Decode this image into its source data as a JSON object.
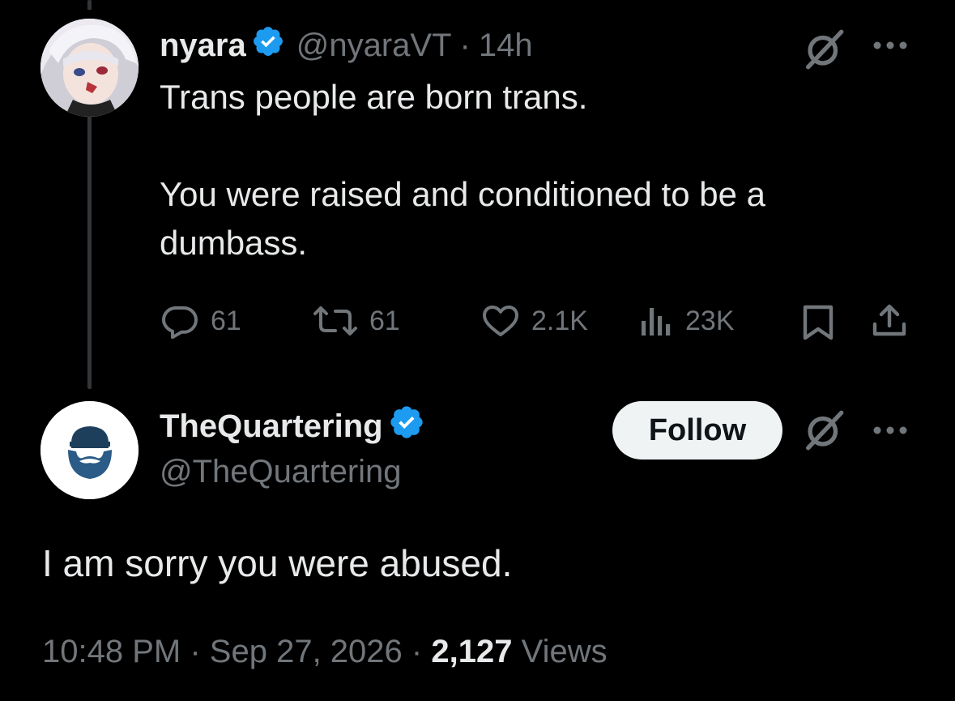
{
  "parent_tweet": {
    "display_name": "nyara",
    "handle": "@nyaraVT",
    "separator": "·",
    "time": "14h",
    "text_line1": "Trans people are born trans.",
    "text_line2": "You were raised and conditioned to be a",
    "text_line3": "dumbass.",
    "replies": "61",
    "reposts": "61",
    "likes": "2.1K",
    "views": "23K"
  },
  "main_tweet": {
    "display_name": "TheQuartering",
    "handle": "@TheQuartering",
    "follow_label": "Follow",
    "text": "I am sorry you were abused.",
    "time": "10:48 PM",
    "sep1": "·",
    "date": "Sep 27, 2026",
    "sep2": "·",
    "views_count": "2,127",
    "views_label": "Views"
  },
  "colors": {
    "background": "#000000",
    "text": "#e7e9ea",
    "secondary": "#71767b",
    "verified": "#1d9bf0",
    "follow_bg": "#eff3f4"
  },
  "icons": [
    "verified-badge-icon",
    "grok-icon",
    "more-icon",
    "reply-icon",
    "repost-icon",
    "like-icon",
    "views-icon",
    "bookmark-icon",
    "share-icon",
    "beard-logo-icon"
  ]
}
